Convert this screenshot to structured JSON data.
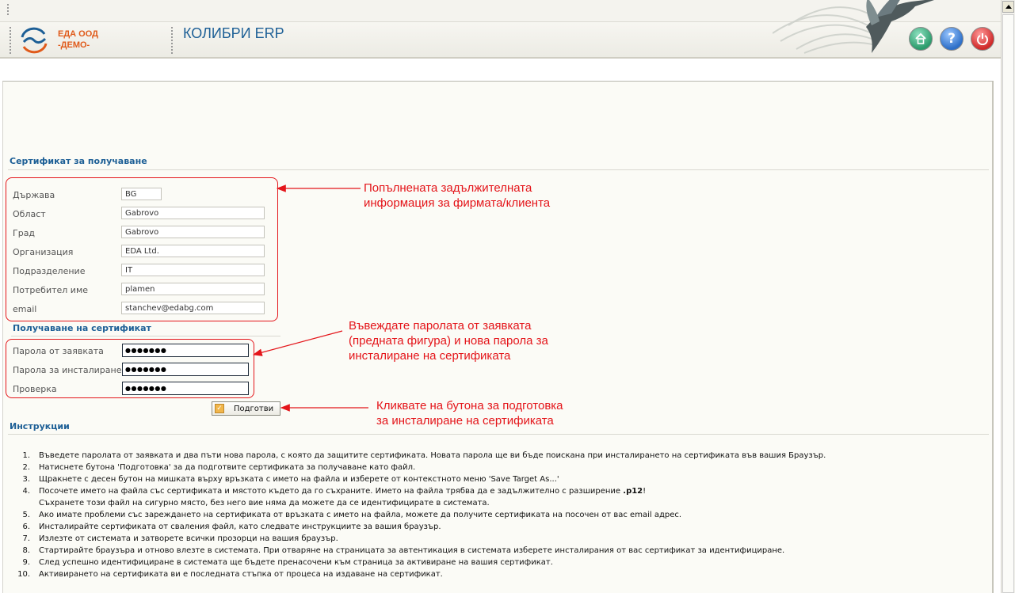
{
  "header": {
    "company_line1": "ЕДА ООД",
    "company_line2": "-ДЕМО-",
    "app_title": "КОЛИБРИ ERP",
    "buttons": {
      "home_icon": "home-icon",
      "help_label": "?",
      "power_icon": "power-icon"
    }
  },
  "certificate_section": {
    "title": "Сертификат за получаване",
    "fields": [
      {
        "label": "Държава",
        "value": "BG"
      },
      {
        "label": "Област",
        "value": "Gabrovo"
      },
      {
        "label": "Град",
        "value": "Gabrovo"
      },
      {
        "label": "Организация",
        "value": "EDA Ltd."
      },
      {
        "label": "Подразделение",
        "value": "IT"
      },
      {
        "label": "Потребител име",
        "value": "plamen"
      },
      {
        "label": "email",
        "value": "stanchev@edabg.com"
      }
    ]
  },
  "receive_section": {
    "title": "Получаване на сертификат",
    "fields": [
      {
        "label": "Парола от заявката",
        "value": "●●●●●●●"
      },
      {
        "label": "Парола за инсталиране",
        "value": "●●●●●●●"
      },
      {
        "label": "Проверка",
        "value": "●●●●●●●"
      }
    ],
    "submit_label": "Подготви"
  },
  "annotations": {
    "a1_line1": "Попълнената задължителната",
    "a1_line2": "информация за фирмата/клиента",
    "a2_line1": "Въвеждате паролата от заявката",
    "a2_line2": "(предната фигура) и нова парола за",
    "a2_line3": "инсталиране на сертификата",
    "a3_line1": "Кликвате на бутона за подготовка",
    "a3_line2": "за инсталиране на сертификата",
    "color": "#e4151a"
  },
  "instructions": {
    "title": "Инструкции",
    "items": [
      {
        "num": "1.",
        "text": "Въведете паролата от заявката и два пъти нова парола, с която да защитите сертификата. Новата парола ще ви бъде поискана при инсталирането на сертификата във вашия Браузър."
      },
      {
        "num": "2.",
        "text": "Натиснете бутона 'Подготовка' за да подготвите сертификата за получаване като файл."
      },
      {
        "num": "3.",
        "text": "Щракнете с десен бутон на мишката върху връзката с името на файла и изберете от контекстното меню 'Save Target As...'"
      },
      {
        "num": "4.",
        "text_before": "Посочете името на файла със сертификата и мястото където да го съхраните. Името на файла трябва да е задължително с разширение ",
        "text_bold": ".p12",
        "text_after": "!",
        "text_line2": "Съхранете този файл на сигурно място, без него вие няма да можете да се идентифицирате в системата."
      },
      {
        "num": "5.",
        "text": "Ако имате проблеми със зареждането на сертификата от връзката с името на файла, можете да получите сертификата на посочен от вас email адрес."
      },
      {
        "num": "6.",
        "text": "Инсталирайте сертификата от сваления файл, като следвате инструкциите за вашия браузър."
      },
      {
        "num": "7.",
        "text": "Излезте от системата и затворете всички прозорци на вашия браузър."
      },
      {
        "num": "8.",
        "text": "Стартирайте браузъра и отново влезте в системата. При отваряне на страницата за автентикация в системата изберете инсталирания от вас сертификат за идентифициране."
      },
      {
        "num": "9.",
        "text": "След успешно идентифициране в системата ще бъдете пренасочени към страница за активиране на вашия сертификат."
      },
      {
        "num": "10.",
        "text": "Активирането на сертификата ви е последната стъпка от процеса на издаване на сертификат."
      }
    ]
  }
}
